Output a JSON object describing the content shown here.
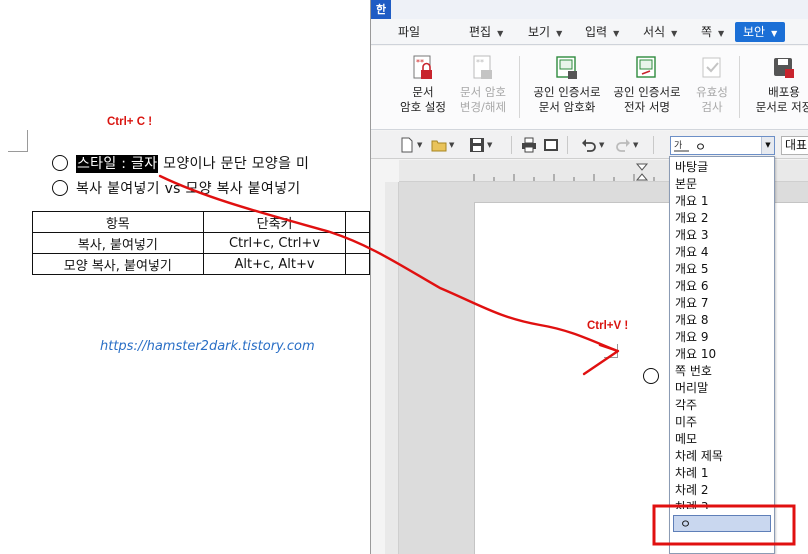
{
  "left_doc": {
    "annotation_copy": "Ctrl+ C !",
    "line1": {
      "highlighted": "스타일 : 글자",
      "rest": " 모양이나 문단 모양을 미"
    },
    "line2": "복사 붙여넣기 vs 모양 복사 붙여넣기",
    "table": {
      "headers": [
        "항목",
        "단축키"
      ],
      "rows": [
        [
          "복사, 붙여넣기",
          "Ctrl+c, Ctrl+v"
        ],
        [
          "모양 복사, 붙여넣기",
          "Alt+c, Alt+v"
        ]
      ]
    },
    "url": "https://hamster2dark.tistory.com"
  },
  "app": {
    "logo": "한",
    "menus": [
      {
        "label": "파일",
        "arrow": false
      },
      {
        "label": "편집",
        "arrow": true
      },
      {
        "label": "보기",
        "arrow": true
      },
      {
        "label": "입력",
        "arrow": true
      },
      {
        "label": "서식",
        "arrow": true
      },
      {
        "label": "쪽",
        "arrow": true
      },
      {
        "label": "보안",
        "arrow": true,
        "active": true
      }
    ],
    "ribbon": [
      {
        "line1": "문서",
        "line2": "암호 설정",
        "icon": "lock-document-icon",
        "disabled": false
      },
      {
        "line1": "문서 암호",
        "line2": "변경/해제",
        "icon": "lock-change-icon",
        "disabled": true
      },
      {
        "line1": "공인 인증서로",
        "line2": "문서 암호화",
        "icon": "certificate-encrypt-icon",
        "disabled": false
      },
      {
        "line1": "공인 인증서로",
        "line2": "전자 서명",
        "icon": "certificate-sign-icon",
        "disabled": false
      },
      {
        "line1": "유효성",
        "line2": "검사",
        "icon": "validate-icon",
        "disabled": true
      },
      {
        "line1": "배포용",
        "line2": "문서로 저장",
        "icon": "distribute-save-icon",
        "disabled": false
      }
    ],
    "style_combo": {
      "value": "ㅇ"
    },
    "font_combo": {
      "value": "대표"
    },
    "annotation_paste": "Ctrl+V !",
    "style_list": [
      "바탕글",
      "본문",
      "개요 1",
      "개요 2",
      "개요 3",
      "개요 4",
      "개요 5",
      "개요 6",
      "개요 7",
      "개요 8",
      "개요 9",
      "개요 10",
      "쪽 번호",
      "머리말",
      "각주",
      "미주",
      "메모",
      "차례 제목",
      "차례 1",
      "차례 2",
      "차례 3"
    ],
    "style_list_selected": "ㅇ"
  },
  "colors": {
    "accent": "#1b6fd6",
    "annotation": "#d9140f",
    "url": "#2a6fc6"
  }
}
